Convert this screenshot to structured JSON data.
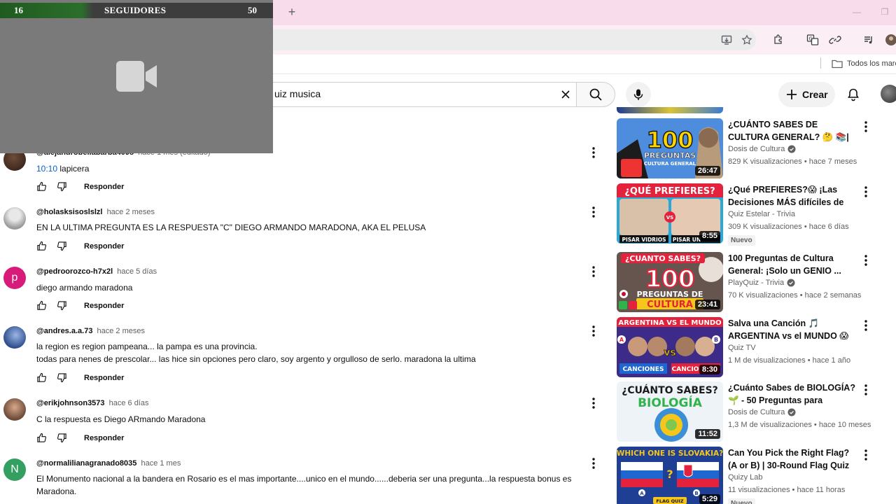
{
  "overlay": {
    "left_number": "16",
    "title": "SEGUIDORES",
    "right_number": "50"
  },
  "bookmarks": {
    "folder_label": "Todos los marc"
  },
  "header": {
    "search_value": "uiz musica",
    "create_label": "Crear"
  },
  "comments": [
    {
      "author": "@alejandrobellabarba4098",
      "time": "hace 1 mes (editado)",
      "timestamp": "10:10",
      "text": " lapicera",
      "reply": "Responder"
    },
    {
      "author": "@holasksisoslslzl",
      "time": "hace 2 meses",
      "text": "EN LA ULTIMA PREGUNTA ES LA RESPUESTA \"C\" DIEGO ARMANDO MARADONA, AKA EL PELUSA",
      "reply": "Responder"
    },
    {
      "author": "@pedroorozco-h7x2l",
      "time": "hace 5 días",
      "avatar_letter": "p",
      "text": "diego armando maradona",
      "reply": "Responder"
    },
    {
      "author": "@andres.a.a.73",
      "time": "hace 2 meses",
      "text_line1": "la region es    region pampeana... la pampa es una provincia.",
      "text_line2": "todas para nenes de prescolar... las hice sin opciones pero claro, soy argento y orgulloso de serlo.  maradona la ultima",
      "reply": "Responder"
    },
    {
      "author": "@erikjohnson3573",
      "time": "hace 6 días",
      "text": "C   la  respuesta es Diego ARmando Maradona",
      "reply": "Responder"
    },
    {
      "author": "@normalilianagranado8035",
      "time": "hace 1 mes",
      "avatar_letter": "N",
      "text": "El Monumento nacional a la bandera en Rosario es el mas importante....unico en el mundo......deberia ser una pregunta...la respuesta bonus es Maradona."
    }
  ],
  "recommendations": [
    {
      "title": "¿CUÁNTO SABES DE CULTURA GENERAL? 🤔 📚| Aprende co...",
      "channel": "Dosis de Cultura",
      "verified": true,
      "views": "829 K visualizaciones",
      "age": "hace 7 meses",
      "duration": "26:47",
      "thumb_text1": "100",
      "thumb_text2": "PREGUNTAS",
      "thumb_text3": "CULTURA GENERAL"
    },
    {
      "title": "¿Qué PREFIERES?😱 ¡Las Decisiones MÁS difíciles de T...",
      "channel": "Quiz Estelar - Trivia",
      "verified": false,
      "views": "309 K visualizaciones",
      "age": "hace 6 días",
      "duration": "8:55",
      "badge": "Nuevo",
      "thumb_text1": "¿QUÉ PREFIERES?",
      "thumb_text2": "PISAR VIDRIOS",
      "thumb_text3": "PISAR UN"
    },
    {
      "title": "100 Preguntas de Cultura General: ¡Solo un GENIO ...",
      "channel": "PlayQuiz - Trivia",
      "verified": true,
      "views": "70 K visualizaciones",
      "age": "hace 2 semanas",
      "duration": "23:41",
      "thumb_text1": "¿CUANTO SABES?",
      "thumb_text2": "100",
      "thumb_text3": "PREGUNTAS DE",
      "thumb_text4": "CULTURA"
    },
    {
      "title": "Salva una Canción 🎵 ARGENTINA vs el MUNDO 😱 ...",
      "channel": "Quiz TV",
      "verified": false,
      "views": "1 M de visualizaciones",
      "age": "hace 1 año",
      "duration": "8:30",
      "thumb_text1": "ARGENTINA VS EL MUNDO",
      "thumb_text2": "CANCIONES",
      "thumb_text3": "CANCIO"
    },
    {
      "title": "¿Cuánto Sabes de BIOLOGÍA? 🌱 - 50 Preguntas para Mente...",
      "channel": "Dosis de Cultura",
      "verified": true,
      "views": "1,3 M de visualizaciones",
      "age": "hace 10 meses",
      "duration": "11:52",
      "thumb_text1": "¿CUÁNTO SABES?",
      "thumb_text2": "BIOLOGÍA"
    },
    {
      "title": "Can You Pick the Right Flag? (A or B) | 30-Round Flag Quiz",
      "channel": "Quizy Lab",
      "verified": false,
      "views": "11 visualizaciones",
      "age": "hace 11 horas",
      "duration": "5:29",
      "badge": "Nuevo",
      "thumb_text1": "WHICH ONE IS SLOVAKIA?",
      "thumb_text2": "FLAG QUIZ"
    }
  ],
  "colors": {
    "tabstrip": "#f9dceb",
    "link_blue": "#065fd4",
    "overlay_green": "#2c6e2c"
  }
}
